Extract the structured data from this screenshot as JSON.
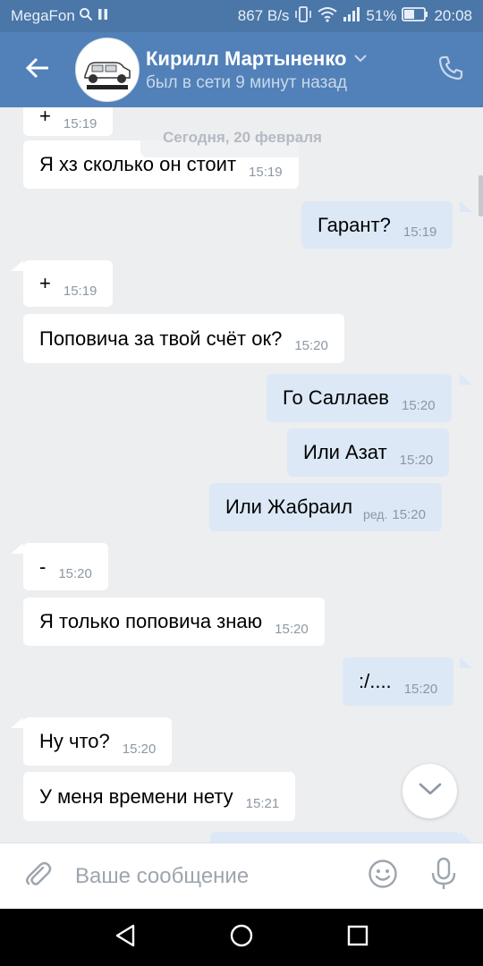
{
  "status_bar": {
    "carrier": "MegaFon",
    "speed": "867 B/s",
    "battery": "51%",
    "time": "20:08",
    "icons": [
      "search-icon",
      "pause-icon",
      "vibrate-icon",
      "wifi-icon",
      "signal-icon",
      "battery-icon"
    ]
  },
  "header": {
    "contact_name": "Кирилл Мартыненко",
    "status": "был в сети 9 минут назад",
    "icons": [
      "back-arrow-icon",
      "avatar",
      "chevron-down-icon",
      "phone-icon"
    ]
  },
  "date_separator": "Сегодня, 20 февраля",
  "messages": [
    {
      "dir": "in",
      "text": "+",
      "time": "15:19"
    },
    {
      "dir": "in",
      "text": "Я хз сколько он стоит",
      "time": "15:19"
    },
    {
      "dir": "out",
      "text": "Гарант?",
      "time": "15:19"
    },
    {
      "dir": "in",
      "text": "+",
      "time": "15:19"
    },
    {
      "dir": "in",
      "text": "Поповича за твой счёт ок?",
      "time": "15:20"
    },
    {
      "dir": "out",
      "text": "Го Саллаев",
      "time": "15:20"
    },
    {
      "dir": "out",
      "text": "Или Азат",
      "time": "15:20"
    },
    {
      "dir": "out",
      "text": "Или Жабраил",
      "edited": "ред.",
      "time": "15:20"
    },
    {
      "dir": "in",
      "text": "-",
      "time": "15:20"
    },
    {
      "dir": "in",
      "text": "Я только поповича знаю",
      "time": "15:20"
    },
    {
      "dir": "out",
      "text": ":/....",
      "time": "15:20"
    },
    {
      "dir": "in",
      "text": "Ну что?",
      "time": "15:20"
    },
    {
      "dir": "in",
      "text": "У меня времени нету",
      "time": "15:21"
    }
  ],
  "composer": {
    "placeholder": "Ваше сообщение",
    "icons": [
      "attach-icon",
      "emoji-icon",
      "mic-icon"
    ]
  },
  "nav_bar": {
    "icons": [
      "nav-back-icon",
      "nav-home-icon",
      "nav-recents-icon"
    ]
  },
  "colors": {
    "header": "#5181b8",
    "status_bar": "#4a76a8",
    "background": "#edeef0",
    "incoming_bubble": "#ffffff",
    "outgoing_bubble": "#dce8f6"
  }
}
